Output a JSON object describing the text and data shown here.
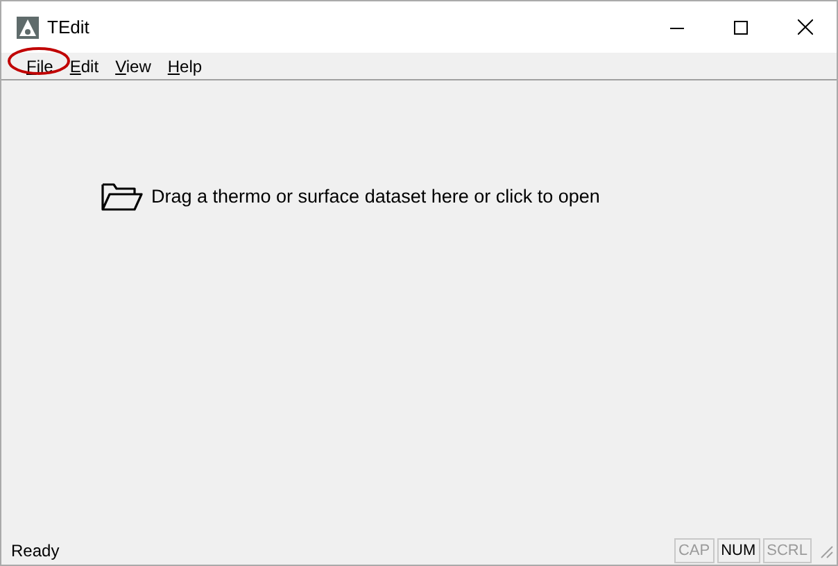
{
  "window": {
    "title": "TEdit"
  },
  "menu": [
    {
      "label": "File",
      "highlighted": true
    },
    {
      "label": "Edit",
      "highlighted": false
    },
    {
      "label": "View",
      "highlighted": false
    },
    {
      "label": "Help",
      "highlighted": false
    }
  ],
  "drop_zone": {
    "text": "Drag a thermo or surface dataset here or click to open"
  },
  "status_bar": {
    "text": "Ready",
    "indicators": [
      {
        "label": "CAP",
        "on": false
      },
      {
        "label": "NUM",
        "on": true
      },
      {
        "label": "SCRL",
        "on": false
      }
    ]
  }
}
